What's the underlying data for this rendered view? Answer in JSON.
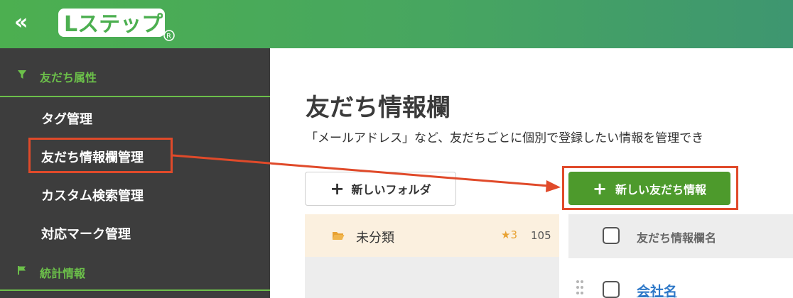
{
  "header": {
    "logo_text": "Lステップ",
    "logo_mark": "®"
  },
  "sidebar": {
    "section_attributes": "友だち属性",
    "items": [
      {
        "label": "タグ管理"
      },
      {
        "label": "友だち情報欄管理"
      },
      {
        "label": "カスタム検索管理"
      },
      {
        "label": "対応マーク管理"
      }
    ],
    "section_stats": "統計情報"
  },
  "main": {
    "title": "友だち情報欄",
    "description": "「メールアドレス」など、友だちごとに個別で登録したい情報を管理でき",
    "new_folder_label": "新しいフォルダ",
    "new_friend_info_label": "新しい友だち情報",
    "plus_glyph": "+"
  },
  "folders": [
    {
      "name": "未分類",
      "star": "★3",
      "count": "105"
    }
  ],
  "table": {
    "column_name": "友だち情報欄名",
    "rows": [
      {
        "name": "会社名"
      }
    ]
  },
  "colors": {
    "header_green": "#4caf50",
    "sidebar_bg": "#3d3d3d",
    "accent_green": "#6cc04a",
    "primary_button": "#4d9a2c",
    "highlight_red": "#e04a2a",
    "link_blue": "#2d78c8"
  }
}
